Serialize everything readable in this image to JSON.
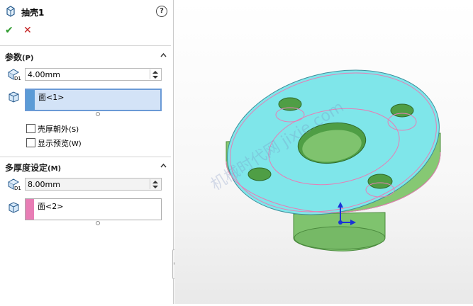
{
  "feature": {
    "title": "抽壳1",
    "help_label": "?",
    "ok_symbol": "✔",
    "cancel_symbol": "✕"
  },
  "params": {
    "header": "参数",
    "header_key": "(P)",
    "thickness": "4.00mm",
    "faces": [
      "面<1>"
    ],
    "shell_outward": "壳厚朝外",
    "shell_outward_key": "(S)",
    "show_preview": "显示预览",
    "show_preview_key": "(W)"
  },
  "multi": {
    "header": "多厚度设定",
    "header_key": "(M)",
    "thickness": "8.00mm",
    "faces": [
      "面<2>"
    ]
  },
  "watermark": "机械时代网 jixie.com",
  "colors": {
    "face_selected": "#5b9bd6",
    "face_multi": "#e87db5",
    "model_body": "#7fc36e",
    "model_top": "#7fe6e8",
    "ok": "#2c9a2c",
    "cancel": "#c41f1f"
  }
}
